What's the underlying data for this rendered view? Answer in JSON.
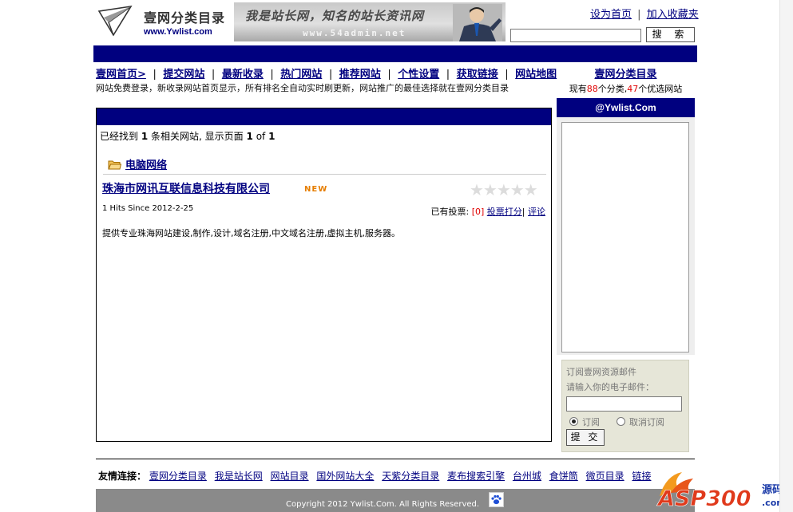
{
  "logo": {
    "title": "壹网分类目录",
    "url": "www.Ywlist.com"
  },
  "banner": {
    "slogan": "我是站长网，知名的站长资讯网",
    "url": "www.54admin.net"
  },
  "toplinks": {
    "set_home": "设为首页",
    "separator": "|",
    "add_favorite": "加入收藏夹"
  },
  "search": {
    "placeholder": "",
    "button_label": "搜 索"
  },
  "nav": {
    "items": [
      "壹网首页>",
      "提交网站",
      "最新收录",
      "热门网站",
      "推荐网站",
      "个性设置",
      "获取链接",
      "网站地图"
    ],
    "divider": "|"
  },
  "notice": "网站免费登录，新收录网站首页显示，所有排名全自动实时刷更新，网站推广的最佳选择就在壹网分类目录",
  "sidebar": {
    "title": "壹网分类目录",
    "stats_prefix": "现有",
    "category_count": "88",
    "stats_mid": "个分类,",
    "site_count": "47",
    "stats_suffix": "个优选网站",
    "header": "@Ywlist.Com",
    "subscribe": {
      "title": "订阅壹网资源邮件",
      "prompt": "请输入你的电子邮件：",
      "email_value": "",
      "option_subscribe": "订阅",
      "option_unsubscribe": "取消订阅",
      "submit_label": "提 交"
    }
  },
  "result": {
    "prefix": "已经找到",
    "count": "1",
    "mid": "条相关网站, 显示页面",
    "page": "1",
    "of": "of",
    "total_pages": "1"
  },
  "listing": {
    "category": "电脑网络",
    "site_title": "珠海市网讯互联信息科技有限公司",
    "badge": "NEW",
    "stars": "★★★★★",
    "hits": "1 Hits Since 2012-2-25",
    "votes_label": "已有投票:",
    "votes_count": "[0]",
    "vote_link": "投票打分",
    "comment_link": "评论",
    "separator": "|",
    "description": "提供专业珠海网站建设,制作,设计,域名注册,中文域名注册,虚拟主机,服务器。"
  },
  "friend_links": {
    "label": "友情连接：",
    "items": [
      "壹网分类目录",
      "我是站长网",
      "网站目录",
      "国外网站大全",
      "天紫分类目录",
      "麦布搜索引擎",
      "台州城",
      "食饼筒",
      "微页目录",
      "链接"
    ]
  },
  "footer": {
    "copyright": "Copyright 2012 Ywlist.Com. All Rights Reserved."
  },
  "watermark": {
    "brand": "ASP300",
    "source": "源码",
    "domain": ".com"
  },
  "colors": {
    "navy": "#00007f",
    "link": "#000080",
    "highlight_red": "#e00000",
    "badge_orange": "#e67e00",
    "footer_gray": "#8a8a8a"
  }
}
